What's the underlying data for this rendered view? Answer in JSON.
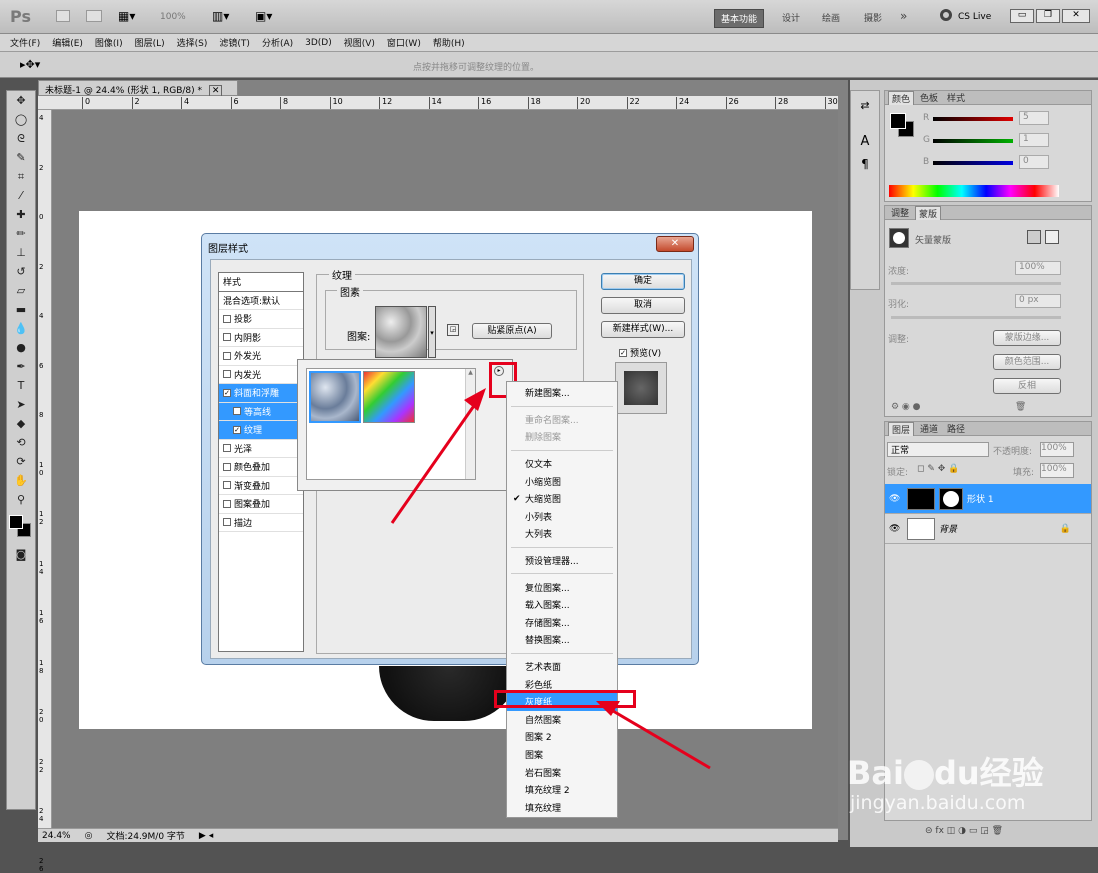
{
  "app": {
    "logo": "Ps",
    "zoom_display": "100%",
    "workspaces": [
      "基本功能",
      "设计",
      "绘画",
      "摄影",
      "»"
    ],
    "cslive": "CS Live"
  },
  "menu": [
    "文件(F)",
    "编辑(E)",
    "图像(I)",
    "图层(L)",
    "选择(S)",
    "滤镜(T)",
    "分析(A)",
    "3D(D)",
    "视图(V)",
    "窗口(W)",
    "帮助(H)"
  ],
  "options_hint": "点按并拖移可调整纹理的位置。",
  "document": {
    "tab_title": "未标题-1 @ 24.4% (形状 1, RGB/8) *",
    "ruler_h": [
      "0",
      "2",
      "4",
      "6",
      "8",
      "10",
      "12",
      "14",
      "16",
      "18",
      "20",
      "22",
      "24",
      "26",
      "28",
      "30"
    ],
    "ruler_v": [
      "4",
      "2",
      "0",
      "2",
      "4",
      "6",
      "8",
      "1\n0",
      "1\n2",
      "1\n4",
      "1\n6",
      "1\n8",
      "2\n0",
      "2\n2",
      "2\n4",
      "2\n6"
    ],
    "zoom": "24.4%",
    "status": "文档:24.9M/0 字节"
  },
  "dialog": {
    "title": "图层样式",
    "close": "✕",
    "styles_header": "样式",
    "styles": [
      {
        "label": "混合选项:默认",
        "checkbox": false,
        "checked": false,
        "highlight": false,
        "indent": false
      },
      {
        "label": "投影",
        "checkbox": true,
        "checked": false,
        "highlight": false,
        "indent": false
      },
      {
        "label": "内阴影",
        "checkbox": true,
        "checked": false,
        "highlight": false,
        "indent": false
      },
      {
        "label": "外发光",
        "checkbox": true,
        "checked": false,
        "highlight": false,
        "indent": false
      },
      {
        "label": "内发光",
        "checkbox": true,
        "checked": false,
        "highlight": false,
        "indent": false
      },
      {
        "label": "斜面和浮雕",
        "checkbox": true,
        "checked": true,
        "highlight": true,
        "indent": false
      },
      {
        "label": "等高线",
        "checkbox": true,
        "checked": false,
        "highlight": true,
        "indent": true
      },
      {
        "label": "纹理",
        "checkbox": true,
        "checked": true,
        "highlight": true,
        "indent": true
      },
      {
        "label": "光泽",
        "checkbox": true,
        "checked": false,
        "highlight": false,
        "indent": false
      },
      {
        "label": "颜色叠加",
        "checkbox": true,
        "checked": false,
        "highlight": false,
        "indent": false
      },
      {
        "label": "渐变叠加",
        "checkbox": true,
        "checked": false,
        "highlight": false,
        "indent": false
      },
      {
        "label": "图案叠加",
        "checkbox": true,
        "checked": false,
        "highlight": false,
        "indent": false
      },
      {
        "label": "描边",
        "checkbox": true,
        "checked": false,
        "highlight": false,
        "indent": false
      }
    ],
    "group_title": "纹理",
    "subgroup_title": "图素",
    "pattern_label": "图案:",
    "snap_button": "贴紧原点(A)",
    "ok": "确定",
    "cancel": "取消",
    "new_style": "新建样式(W)...",
    "preview_label": "预览(V)"
  },
  "context_menu": {
    "items": [
      {
        "label": "新建图案...",
        "disabled": false,
        "checked": false,
        "selected": false
      },
      {
        "sep": true
      },
      {
        "label": "重命名图案...",
        "disabled": true,
        "checked": false,
        "selected": false
      },
      {
        "label": "删除图案",
        "disabled": true,
        "checked": false,
        "selected": false
      },
      {
        "sep": true
      },
      {
        "label": "仅文本",
        "disabled": false,
        "checked": false,
        "selected": false
      },
      {
        "label": "小缩览图",
        "disabled": false,
        "checked": false,
        "selected": false
      },
      {
        "label": "大缩览图",
        "disabled": false,
        "checked": true,
        "selected": false
      },
      {
        "label": "小列表",
        "disabled": false,
        "checked": false,
        "selected": false
      },
      {
        "label": "大列表",
        "disabled": false,
        "checked": false,
        "selected": false
      },
      {
        "sep": true
      },
      {
        "label": "预设管理器...",
        "disabled": false,
        "checked": false,
        "selected": false
      },
      {
        "sep": true
      },
      {
        "label": "复位图案...",
        "disabled": false,
        "checked": false,
        "selected": false
      },
      {
        "label": "载入图案...",
        "disabled": false,
        "checked": false,
        "selected": false
      },
      {
        "label": "存储图案...",
        "disabled": false,
        "checked": false,
        "selected": false
      },
      {
        "label": "替换图案...",
        "disabled": false,
        "checked": false,
        "selected": false
      },
      {
        "sep": true
      },
      {
        "label": "艺术表面",
        "disabled": false,
        "checked": false,
        "selected": false
      },
      {
        "label": "彩色纸",
        "disabled": false,
        "checked": false,
        "selected": false
      },
      {
        "label": "灰度纸",
        "disabled": false,
        "checked": false,
        "selected": true
      },
      {
        "label": "自然图案",
        "disabled": false,
        "checked": false,
        "selected": false
      },
      {
        "label": "图案 2",
        "disabled": false,
        "checked": false,
        "selected": false
      },
      {
        "label": "图案",
        "disabled": false,
        "checked": false,
        "selected": false
      },
      {
        "label": "岩石图案",
        "disabled": false,
        "checked": false,
        "selected": false
      },
      {
        "label": "填充纹理 2",
        "disabled": false,
        "checked": false,
        "selected": false
      },
      {
        "label": "填充纹理",
        "disabled": false,
        "checked": false,
        "selected": false
      }
    ]
  },
  "color_panel": {
    "tabs": [
      "颜色",
      "色板",
      "样式"
    ],
    "sliders": [
      {
        "label": "R",
        "value": "5",
        "color": "#e00000"
      },
      {
        "label": "G",
        "value": "1",
        "color": "#00b000"
      },
      {
        "label": "B",
        "value": "0",
        "color": "#0000e0"
      }
    ]
  },
  "adjust_panel": {
    "tabs": [
      "调整",
      "蒙版"
    ],
    "mask_label": "矢量蒙版",
    "density_label": "浓度:",
    "density_value": "100%",
    "feather_label": "羽化:",
    "feather_value": "0 px",
    "refine_label": "调整:",
    "btn_edge": "蒙版边缘...",
    "btn_range": "颜色范围...",
    "btn_invert": "反相"
  },
  "layers_panel": {
    "tabs": [
      "图层",
      "通道",
      "路径"
    ],
    "blend": "正常",
    "opacity_label": "不透明度:",
    "opacity": "100%",
    "lock_label": "锁定:",
    "fill_label": "填充:",
    "fill": "100%",
    "layers": [
      {
        "name": "形状 1",
        "selected": true
      },
      {
        "name": "背景",
        "selected": false
      }
    ]
  },
  "watermark": {
    "brand": "Bai",
    "brand2": "du",
    "brand_cn": "经验",
    "url": "jingyan.baidu.com"
  }
}
